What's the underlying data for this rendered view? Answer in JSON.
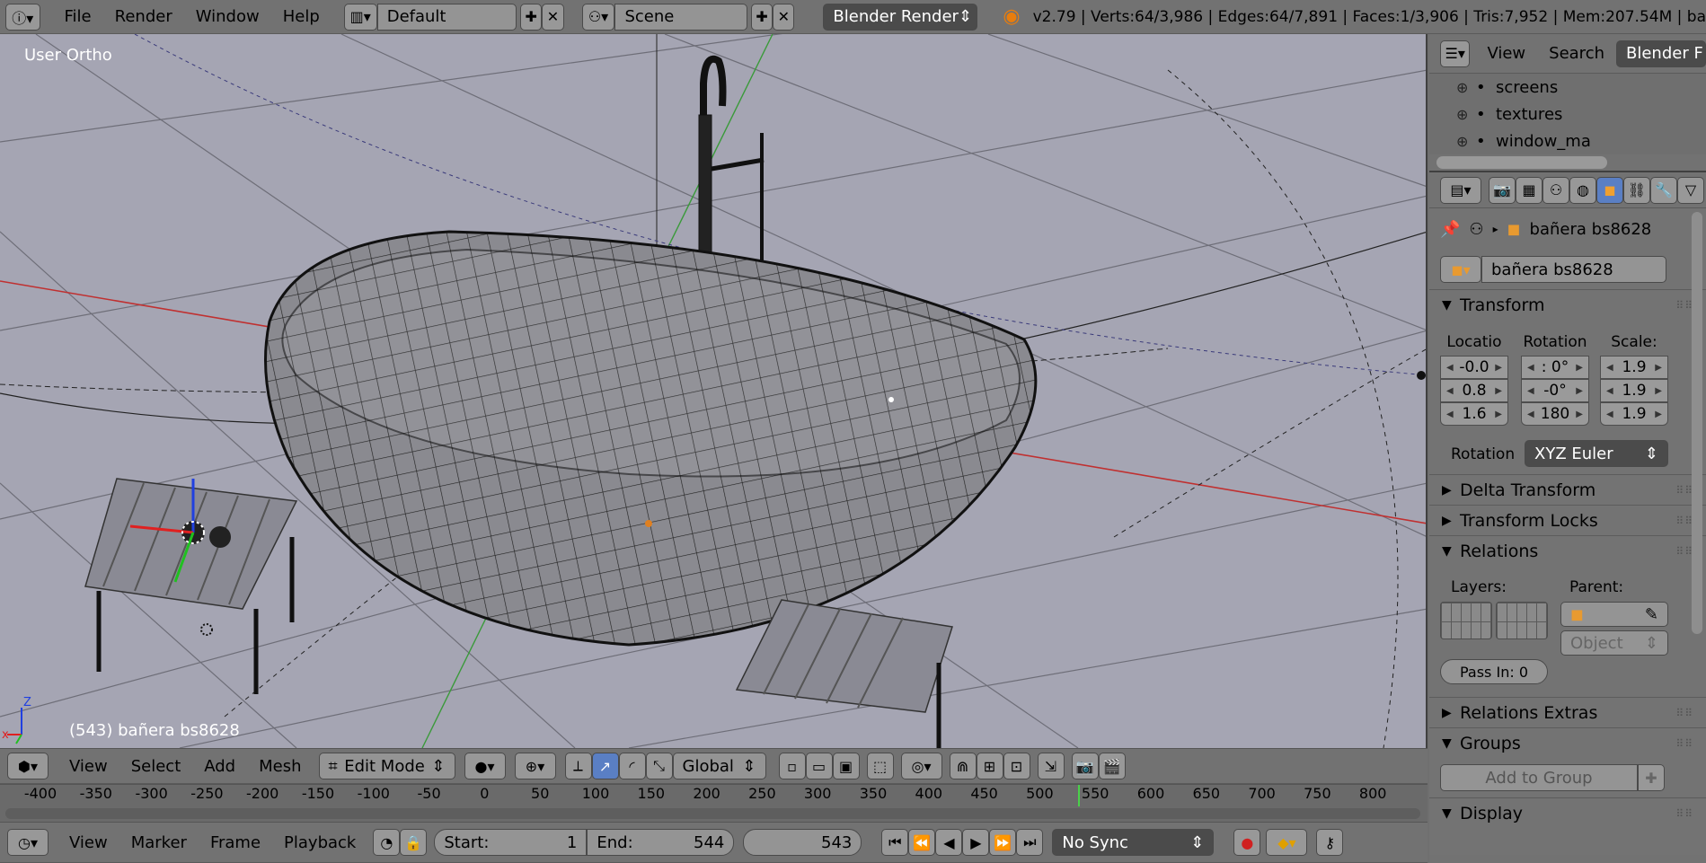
{
  "top_bar": {
    "menus": [
      "File",
      "Render",
      "Window",
      "Help"
    ],
    "layout": "Default",
    "scene": "Scene",
    "engine": "Blender Render",
    "stats": "v2.79 | Verts:64/3,986 | Edges:64/7,891 | Faces:1/3,906 | Tris:7,952 | Mem:207.54M | ba"
  },
  "viewport": {
    "view_label": "User Ortho",
    "object_label": "(543) bañera bs8628",
    "axis_z": "Z",
    "axis_x": "x"
  },
  "viewport_header": {
    "menus": [
      "View",
      "Select",
      "Add",
      "Mesh"
    ],
    "mode": "Edit Mode",
    "orientation": "Global"
  },
  "timeline_ruler": {
    "ticks": [
      "-400",
      "-350",
      "-300",
      "-250",
      "-200",
      "-150",
      "-100",
      "-50",
      "0",
      "50",
      "100",
      "150",
      "200",
      "250",
      "300",
      "350",
      "400",
      "450",
      "500",
      "550",
      "600",
      "650",
      "700",
      "750",
      "800"
    ],
    "current_frame_marker": 543
  },
  "timeline_header": {
    "menus": [
      "View",
      "Marker",
      "Frame",
      "Playback"
    ],
    "start_label": "Start:",
    "start": "1",
    "end_label": "End:",
    "end": "544",
    "current": "543",
    "sync": "No Sync"
  },
  "outliner": {
    "menus": [
      "View",
      "Search"
    ],
    "filter": "Blender F",
    "items": [
      "screens",
      "textures",
      "window_ma"
    ]
  },
  "properties": {
    "object_name": "bañera bs8628",
    "datablock": "bañera bs8628",
    "transform": {
      "title": "Transform",
      "location_label": "Locatio",
      "rotation_label": "Rotation",
      "scale_label": "Scale:",
      "location": [
        "-0.0",
        "0.8",
        "1.6"
      ],
      "rotation": [
        ": 0°",
        "-0°",
        "180"
      ],
      "scale": [
        "1.9",
        "1.9",
        "1.9"
      ],
      "rot_mode_label": "Rotation",
      "rot_mode": "XYZ Euler"
    },
    "delta": "Delta Transform",
    "locks": "Transform Locks",
    "relations": {
      "title": "Relations",
      "layers_label": "Layers:",
      "parent_label": "Parent:",
      "parent_type": "Object",
      "pass_index": "Pass In: 0"
    },
    "relations_extras": "Relations Extras",
    "groups": {
      "title": "Groups",
      "add": "Add to Group"
    },
    "display": "Display"
  },
  "colors": {
    "header": "#727272",
    "viewport_bg": "#a5a5b3",
    "selected_tab": "#5a7fc4"
  }
}
